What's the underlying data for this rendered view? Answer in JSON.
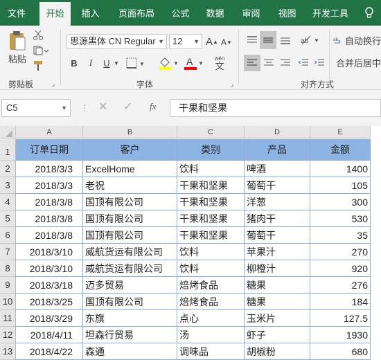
{
  "tabs": [
    "文件",
    "开始",
    "插入",
    "页面布局",
    "公式",
    "数据",
    "审阅",
    "视图",
    "开发工具"
  ],
  "ribbon": {
    "paste_label": "粘贴",
    "clipboard_label": "剪贴板",
    "font_label": "字体",
    "align_label": "对齐方式",
    "font_name": "思源黑体 CN Regular",
    "font_size": "12",
    "wrap_label": "自动换行",
    "merge_label": "合并后居中",
    "bold": "B",
    "italic": "I",
    "underline": "U",
    "grow_font": "A",
    "shrink_font": "A",
    "font_color_letter": "A",
    "phonetic_letter": "文",
    "phonetic_top": "wén"
  },
  "formula": {
    "cell_ref": "C5",
    "fx": "fx",
    "value": "干果和坚果"
  },
  "columns": [
    "A",
    "B",
    "C",
    "D",
    "E"
  ],
  "table": {
    "headers": [
      "订单日期",
      "客户",
      "类别",
      "产品",
      "金额"
    ],
    "rows": [
      [
        "2018/3/3",
        "ExcelHome",
        "饮料",
        "啤酒",
        "1400"
      ],
      [
        "2018/3/3",
        "老祝",
        "干果和坚果",
        "葡萄干",
        "105"
      ],
      [
        "2018/3/8",
        "国顶有限公司",
        "干果和坚果",
        "洋葱",
        "300"
      ],
      [
        "2018/3/8",
        "国顶有限公司",
        "干果和坚果",
        "猪肉干",
        "530"
      ],
      [
        "2018/3/8",
        "国顶有限公司",
        "干果和坚果",
        "葡萄干",
        "35"
      ],
      [
        "2018/3/10",
        "威航货运有限公司",
        "饮料",
        "苹果汁",
        "270"
      ],
      [
        "2018/3/10",
        "威航货运有限公司",
        "饮料",
        "柳橙汁",
        "920"
      ],
      [
        "2018/3/18",
        "迈多贸易",
        "焙烤食品",
        "糖果",
        "276"
      ],
      [
        "2018/3/25",
        "国顶有限公司",
        "焙烤食品",
        "糖果",
        "184"
      ],
      [
        "2018/3/29",
        "东旗",
        "点心",
        "玉米片",
        "127.5"
      ],
      [
        "2018/4/11",
        "坦森行贸易",
        "汤",
        "虾子",
        "1930"
      ],
      [
        "2018/4/22",
        "森通",
        "调味品",
        "胡椒粉",
        "680"
      ]
    ]
  },
  "row_numbers": [
    "1",
    "2",
    "3",
    "4",
    "5",
    "6",
    "7",
    "8",
    "9",
    "10",
    "11",
    "12",
    "13"
  ],
  "colors": {
    "excel_green": "#217346",
    "header_fill": "#8eb4e3",
    "border": "#8eaadb"
  }
}
